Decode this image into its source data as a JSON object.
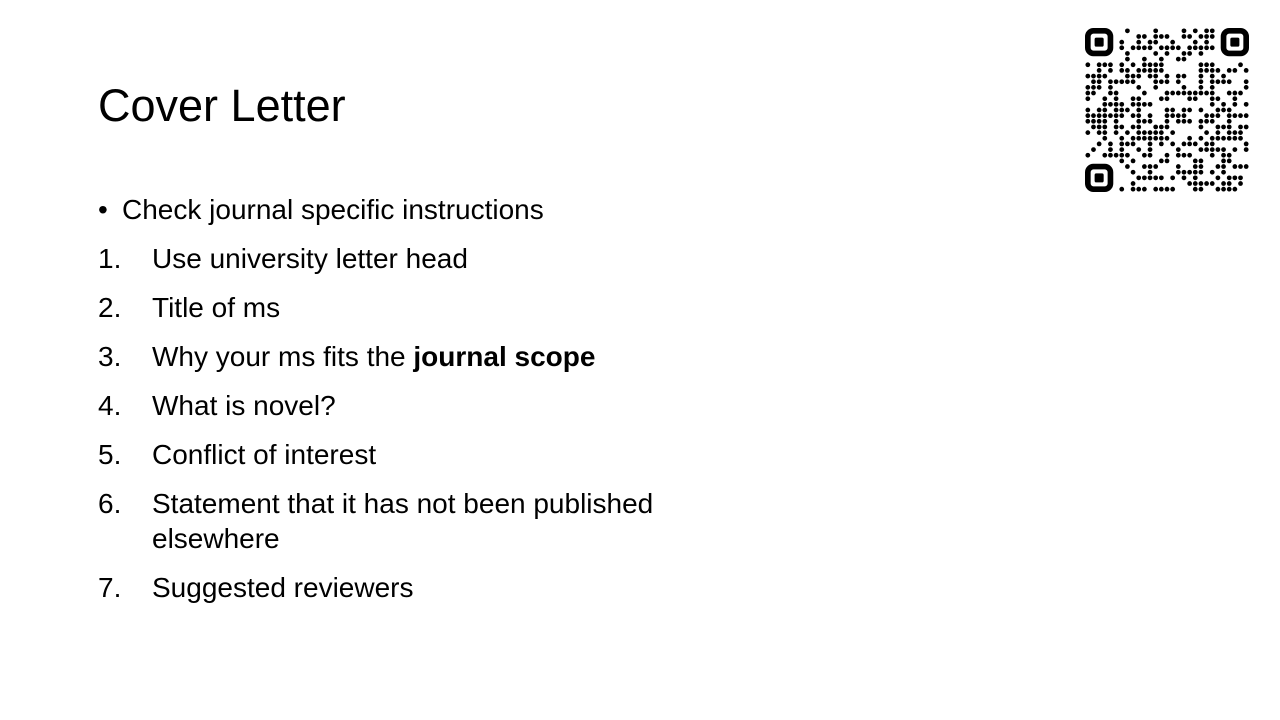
{
  "slide": {
    "title": "Cover Letter",
    "bullet": {
      "marker": "•",
      "text": "Check journal specific instructions"
    },
    "items": [
      {
        "marker": "1.",
        "text": "Use university letter head"
      },
      {
        "marker": "2.",
        "text": "Title of ms"
      },
      {
        "marker": "3.",
        "text": "Why your ms fits the ",
        "bold": "journal scope"
      },
      {
        "marker": "4.",
        "text": "What is novel?"
      },
      {
        "marker": "5.",
        "text": "Conflict of interest"
      },
      {
        "marker": "6.",
        "text": "Statement that it has not been published elsewhere"
      },
      {
        "marker": "7.",
        "text": "Suggested reviewers"
      }
    ]
  },
  "qr_code": {
    "icon": "qr-code-icon"
  }
}
